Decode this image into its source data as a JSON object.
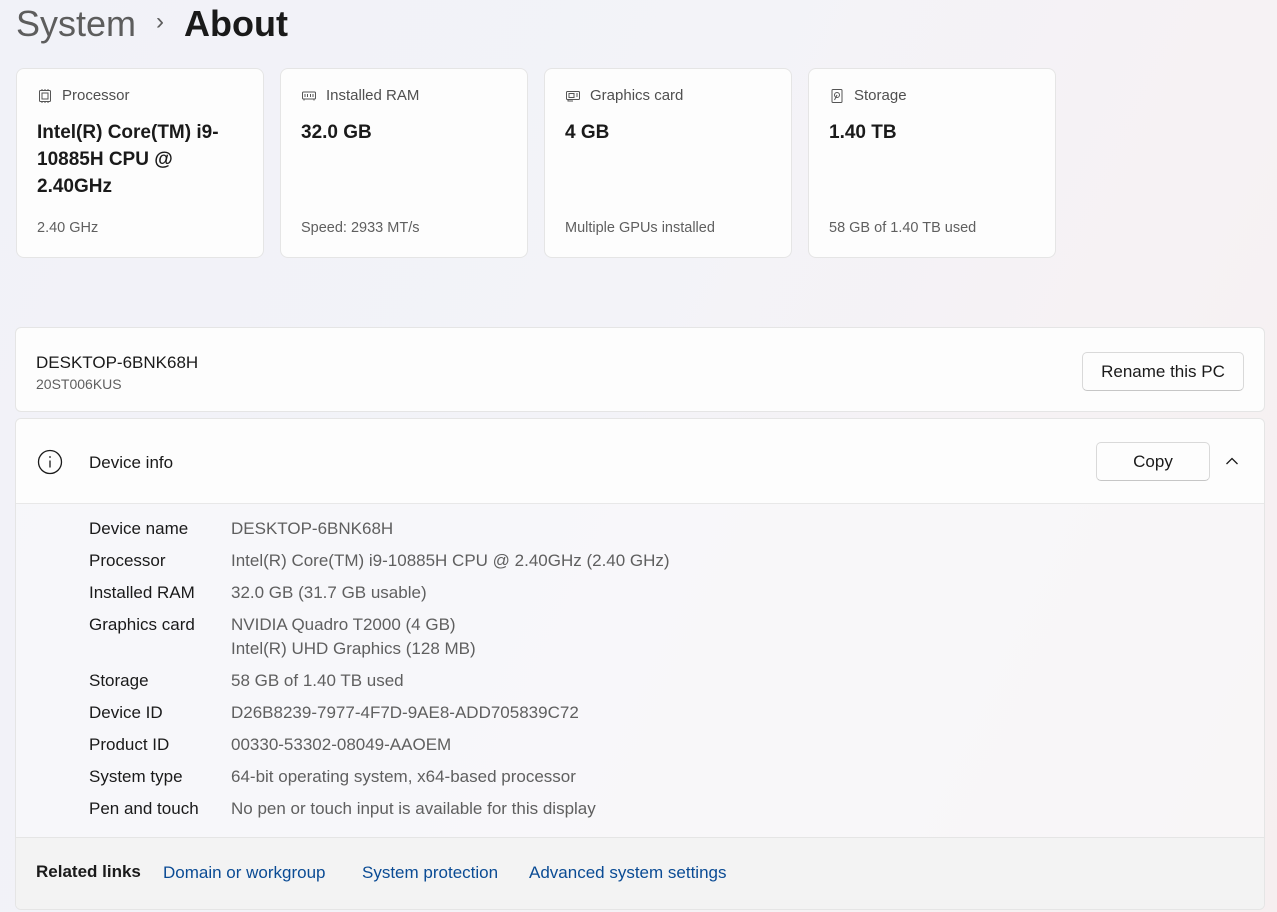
{
  "breadcrumb": {
    "parent": "System",
    "separator": "›",
    "current": "About"
  },
  "cards": [
    {
      "icon": "processor-icon",
      "title": "Processor",
      "value": "Intel(R) Core(TM) i9-10885H CPU @ 2.40GHz",
      "sub": "2.40 GHz"
    },
    {
      "icon": "ram-icon",
      "title": "Installed RAM",
      "value": "32.0 GB",
      "sub": "Speed: 2933 MT/s"
    },
    {
      "icon": "graphics-card-icon",
      "title": "Graphics card",
      "value": "4 GB",
      "sub": "Multiple GPUs installed"
    },
    {
      "icon": "storage-icon",
      "title": "Storage",
      "value": "1.40 TB",
      "sub": "58 GB of 1.40 TB used"
    }
  ],
  "pc": {
    "name": "DESKTOP-6BNK68H",
    "model": "20ST006KUS",
    "rename_label": "Rename this PC"
  },
  "device_info": {
    "title": "Device info",
    "copy_label": "Copy",
    "specs": [
      {
        "label": "Device name",
        "value": "DESKTOP-6BNK68H"
      },
      {
        "label": "Processor",
        "value": "Intel(R) Core(TM) i9-10885H CPU @ 2.40GHz (2.40 GHz)"
      },
      {
        "label": "Installed RAM",
        "value": "32.0 GB (31.7 GB usable)"
      },
      {
        "label": "Graphics card",
        "value": "NVIDIA Quadro T2000 (4 GB)",
        "value2": "Intel(R) UHD Graphics (128 MB)"
      },
      {
        "label": "Storage",
        "value": "58 GB of 1.40 TB used"
      },
      {
        "label": "Device ID",
        "value": "D26B8239-7977-4F7D-9AE8-ADD705839C72"
      },
      {
        "label": "Product ID",
        "value": "00330-53302-08049-AAOEM"
      },
      {
        "label": "System type",
        "value": "64-bit operating system, x64-based processor"
      },
      {
        "label": "Pen and touch",
        "value": "No pen or touch input is available for this display"
      }
    ]
  },
  "related": {
    "label": "Related links",
    "links": [
      "Domain or workgroup",
      "System protection",
      "Advanced system settings"
    ]
  },
  "colors": {
    "link": "#0a4b94",
    "muted_text": "#5f5f5f"
  }
}
